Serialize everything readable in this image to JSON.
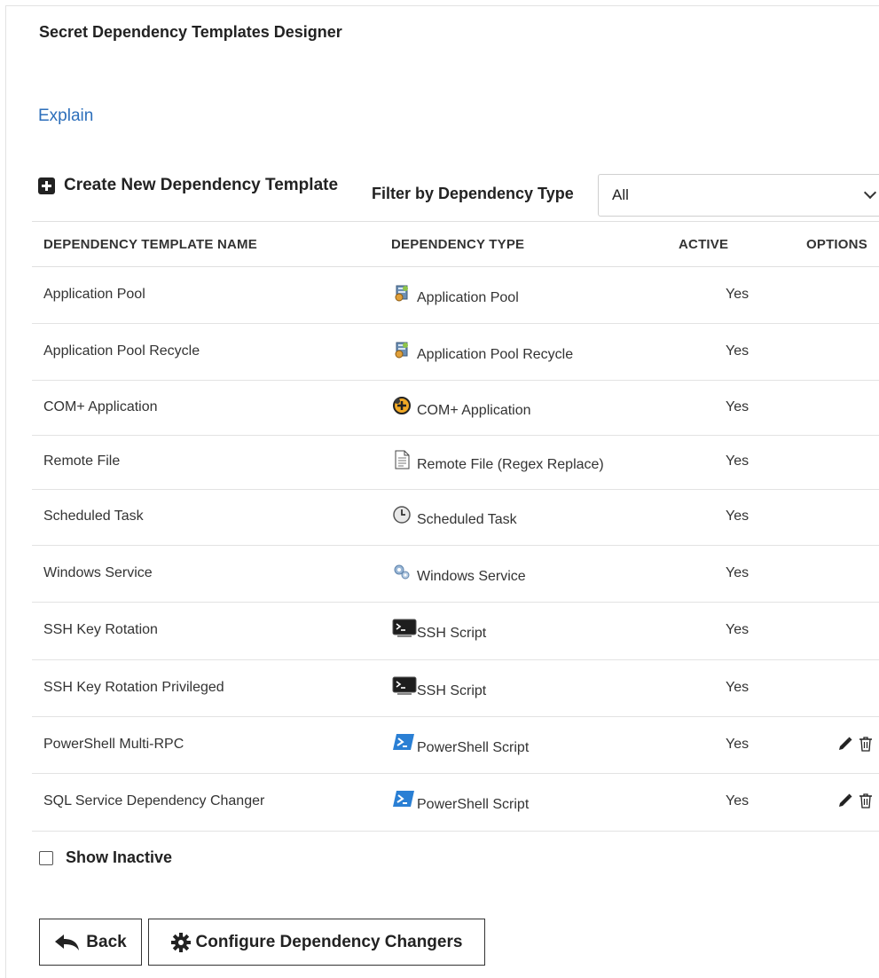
{
  "title": "Secret Dependency Templates Designer",
  "explain_link": "Explain",
  "create_label": "Create New Dependency Template",
  "filter": {
    "label": "Filter by Dependency Type",
    "value": "All"
  },
  "columns": {
    "name": "DEPENDENCY TEMPLATE NAME",
    "type": "DEPENDENCY TYPE",
    "active": "ACTIVE",
    "options": "OPTIONS"
  },
  "rows": [
    {
      "name": "Application Pool",
      "type": "Application Pool",
      "icon": "app-pool-icon",
      "active": "Yes",
      "editable": false
    },
    {
      "name": "Application Pool Recycle",
      "type": "Application Pool Recycle",
      "icon": "app-pool-icon",
      "active": "Yes",
      "editable": false
    },
    {
      "name": "COM+ Application",
      "type": "COM+ Application",
      "icon": "com-plus-icon",
      "active": "Yes",
      "editable": false
    },
    {
      "name": "Remote File",
      "type": "Remote File (Regex Replace)",
      "icon": "document-icon",
      "active": "Yes",
      "editable": false
    },
    {
      "name": "Scheduled Task",
      "type": "Scheduled Task",
      "icon": "clock-icon",
      "active": "Yes",
      "editable": false
    },
    {
      "name": "Windows Service",
      "type": "Windows Service",
      "icon": "gears-icon",
      "active": "Yes",
      "editable": false
    },
    {
      "name": "SSH Key Rotation",
      "type": "SSH Script",
      "icon": "terminal-icon",
      "active": "Yes",
      "editable": false
    },
    {
      "name": "SSH Key Rotation Privileged",
      "type": "SSH Script",
      "icon": "terminal-icon",
      "active": "Yes",
      "editable": false
    },
    {
      "name": "PowerShell Multi-RPC",
      "type": "PowerShell Script",
      "icon": "powershell-icon",
      "active": "Yes",
      "editable": true
    },
    {
      "name": "SQL Service Dependency Changer",
      "type": "PowerShell Script",
      "icon": "powershell-icon",
      "active": "Yes",
      "editable": true
    }
  ],
  "show_inactive_label": "Show Inactive",
  "back_label": "Back",
  "configure_label": "Configure Dependency Changers"
}
